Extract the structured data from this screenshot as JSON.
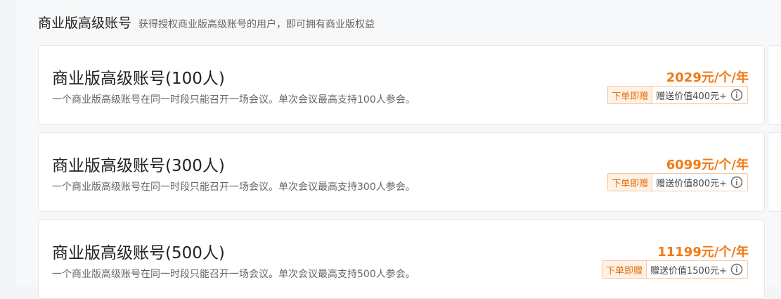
{
  "section": {
    "title": "商业版高级账号",
    "subtitle": "获得授权商业版高级账号的用户，即可拥有商业版权益"
  },
  "plans": [
    {
      "name": "商业版高级账号(100人)",
      "description": "一个商业版高级账号在同一时段只能召开一场会议。单次会议最高支持100人参会。",
      "price": "2029元/个/年",
      "gift_tag": "下单即赠",
      "gift_value": "赠送价值400元+"
    },
    {
      "name": "商业版高级账号(300人)",
      "description": "一个商业版高级账号在同一时段只能召开一场会议。单次会议最高支持300人参会。",
      "price": "6099元/个/年",
      "gift_tag": "下单即赠",
      "gift_value": "赠送价值800元+"
    },
    {
      "name": "商业版高级账号(500人)",
      "description": "一个商业版高级账号在同一时段只能召开一场会议。单次会议最高支持500人参会。",
      "price": "11199元/个/年",
      "gift_tag": "下单即赠",
      "gift_value": "赠送价值1500元+"
    }
  ],
  "icons": {
    "info": "info-circle-icon"
  },
  "colors": {
    "price": "#f07b15",
    "gift_tag_text": "#e26f11",
    "gift_tag_background": "#fff1e3",
    "gift_border": "#f5c9a3",
    "card_border": "#e6e7ea",
    "page_background": "#f7f8fa"
  }
}
